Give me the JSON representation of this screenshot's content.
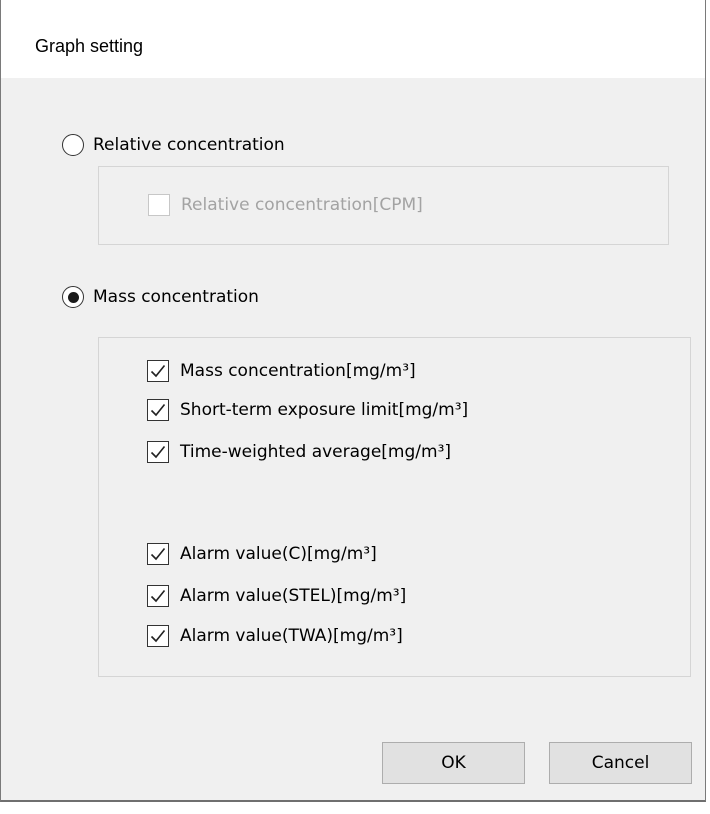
{
  "dialog": {
    "title": "Graph setting"
  },
  "relative": {
    "radio_label": "Relative concentration",
    "selected": false,
    "options": [
      {
        "label": "Relative concentration[CPM]",
        "checked": false,
        "enabled": false
      }
    ]
  },
  "mass": {
    "radio_label": "Mass concentration",
    "selected": true,
    "options": [
      {
        "label": "Mass concentration[mg/m³]",
        "checked": true,
        "enabled": true
      },
      {
        "label": "Short-term exposure limit[mg/m³]",
        "checked": true,
        "enabled": true
      },
      {
        "label": "Time-weighted average[mg/m³]",
        "checked": true,
        "enabled": true
      },
      {
        "label": "Alarm value(C)[mg/m³]",
        "checked": true,
        "enabled": true
      },
      {
        "label": "Alarm value(STEL)[mg/m³]",
        "checked": true,
        "enabled": true
      },
      {
        "label": "Alarm value(TWA)[mg/m³]",
        "checked": true,
        "enabled": true
      }
    ]
  },
  "buttons": {
    "ok": "OK",
    "cancel": "Cancel"
  },
  "icons": {
    "checkmark": "check-icon",
    "radio_dot": "radio-dot-icon"
  }
}
